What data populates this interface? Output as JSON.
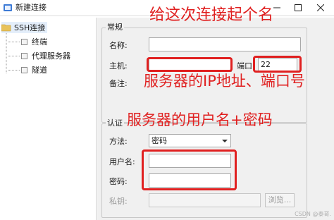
{
  "window": {
    "title": "新建连接"
  },
  "tree": {
    "root": "SSH连接",
    "items": [
      {
        "label": "终端"
      },
      {
        "label": "代理服务器"
      },
      {
        "label": "隧道"
      }
    ]
  },
  "general": {
    "group_title": "常规",
    "name_label": "名称:",
    "name_value": "",
    "host_label": "主机:",
    "host_value": "",
    "port_label": "端口:",
    "port_value": "22",
    "note_label": "备注:"
  },
  "auth": {
    "group_title": "认证",
    "method_label": "方法:",
    "method_value": "密码",
    "user_label": "用户名:",
    "user_value": "",
    "password_label": "密码:",
    "password_value": "",
    "key_label": "私钥:",
    "key_value": "",
    "browse_label": "浏览..."
  },
  "annotations": {
    "name_hint": "给这次连接起个名",
    "host_hint": "服务器的IP地址、端口号",
    "auth_hint": "服务器的用户名+密码"
  },
  "watermark": "CSDN @泰哥.",
  "colors": {
    "annotation": "#e02020",
    "selection": "#e4eefa"
  }
}
